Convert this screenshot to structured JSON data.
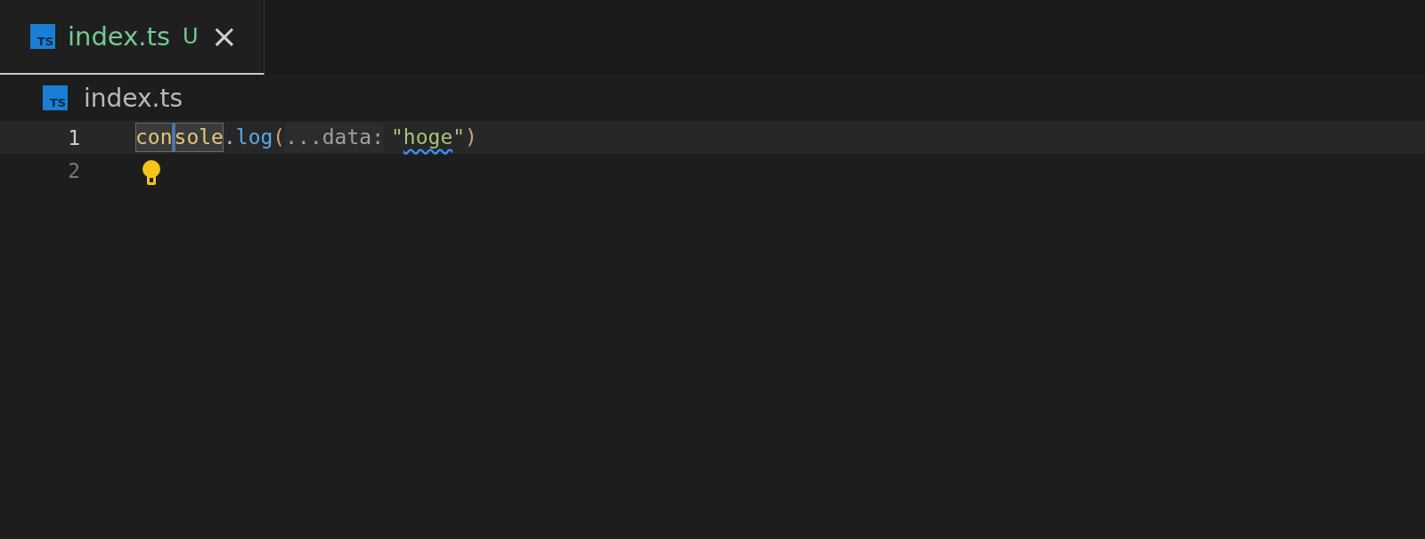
{
  "tabs": [
    {
      "icon_text": "TS",
      "label": "index.ts",
      "status": "U",
      "selected": true,
      "close": "×"
    }
  ],
  "breadcrumb": {
    "icon_text": "TS",
    "label": "index.ts"
  },
  "lines": [
    {
      "number": "1",
      "active": true,
      "lightbulb": false,
      "tokens": [
        {
          "text": "con",
          "kind": "variable",
          "highlighted": true,
          "cursor": false,
          "squiggle": false
        },
        {
          "text": "sole",
          "kind": "variable",
          "highlighted": true,
          "cursor": true,
          "squiggle": false
        },
        {
          "text": ".",
          "kind": "punct",
          "highlighted": false,
          "cursor": false,
          "squiggle": false
        },
        {
          "text": "log",
          "kind": "function",
          "highlighted": false,
          "cursor": false,
          "squiggle": false
        },
        {
          "text": "(",
          "kind": "bracket",
          "highlighted": false,
          "cursor": false,
          "squiggle": false
        },
        {
          "text": "...data:",
          "kind": "hint",
          "highlighted": false,
          "cursor": false,
          "squiggle": false
        },
        {
          "text": "\"",
          "kind": "string",
          "highlighted": false,
          "cursor": false,
          "squiggle": false
        },
        {
          "text": "hoge",
          "kind": "string",
          "highlighted": false,
          "cursor": false,
          "squiggle": true
        },
        {
          "text": "\"",
          "kind": "string",
          "highlighted": false,
          "cursor": false,
          "squiggle": false
        },
        {
          "text": ")",
          "kind": "bracket",
          "highlighted": false,
          "cursor": false,
          "squiggle": false
        }
      ]
    },
    {
      "number": "2",
      "active": false,
      "lightbulb": true
    }
  ]
}
